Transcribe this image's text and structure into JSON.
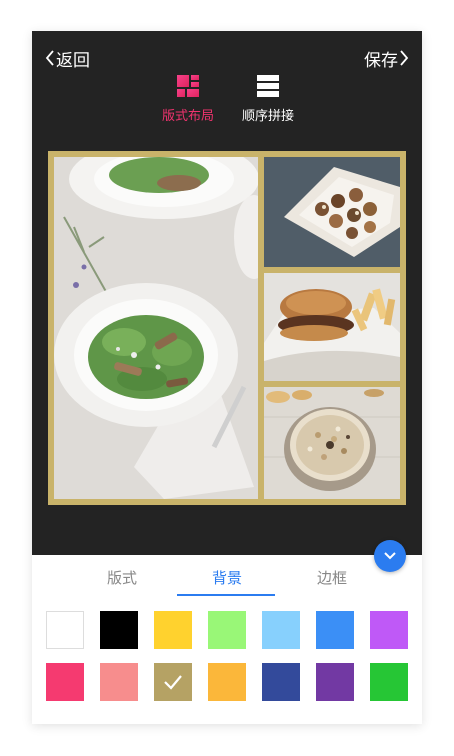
{
  "nav": {
    "back_label": "返回",
    "save_label": "保存"
  },
  "modes": [
    {
      "label": "版式布局",
      "icon": "grid-layout-icon",
      "active": true,
      "color": "#f0336e"
    },
    {
      "label": "顺序拼接",
      "icon": "stack-rows-icon",
      "active": false,
      "color": "#ffffff"
    }
  ],
  "collage": {
    "border_color": "#c9b36a",
    "cells": [
      {
        "name": "salad-plate-photo"
      },
      {
        "name": "pastry-box-photo"
      },
      {
        "name": "burger-basket-photo"
      },
      {
        "name": "granola-bowl-photo"
      }
    ]
  },
  "tabs": [
    {
      "label": "版式",
      "active": false
    },
    {
      "label": "背景",
      "active": true
    },
    {
      "label": "边框",
      "active": false
    }
  ],
  "accent_color": "#2b7cf0",
  "swatches": [
    {
      "color": "#ffffff",
      "selected": false
    },
    {
      "color": "#000000",
      "selected": false
    },
    {
      "color": "#ffd22e",
      "selected": false
    },
    {
      "color": "#99f777",
      "selected": false
    },
    {
      "color": "#87d0fd",
      "selected": false
    },
    {
      "color": "#3b8ff6",
      "selected": false
    },
    {
      "color": "#bf59f7",
      "selected": false
    },
    {
      "color": "#f53a70",
      "selected": false
    },
    {
      "color": "#f78d8d",
      "selected": false
    },
    {
      "color": "#b5a264",
      "selected": true
    },
    {
      "color": "#fbb73a",
      "selected": false
    },
    {
      "color": "#334a9b",
      "selected": false
    },
    {
      "color": "#7239a3",
      "selected": false
    },
    {
      "color": "#26c635",
      "selected": false
    }
  ],
  "pager": {
    "pages": 2,
    "current": 1
  }
}
